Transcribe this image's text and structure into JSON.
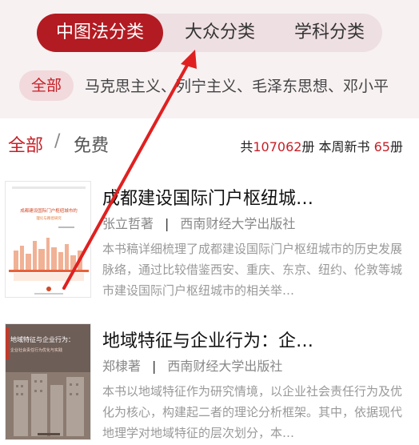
{
  "tabs": [
    {
      "label": "中图法分类",
      "active": true
    },
    {
      "label": "大众分类",
      "active": false
    },
    {
      "label": "学科分类",
      "active": false
    }
  ],
  "categories": {
    "all_label": "全部",
    "items_text": "马克思主义、列宁主义、毛泽东思想、邓小平"
  },
  "filter": {
    "all_label": "全部",
    "separator": "/",
    "free_label": "免费"
  },
  "stats": {
    "prefix": "共",
    "total": "107062",
    "total_unit": "册 本周新书 ",
    "new": "65",
    "new_unit": "册"
  },
  "books": [
    {
      "title": "成都建设国际门户枢纽城…",
      "author": "张立哲著",
      "publisher": "西南财经大学出版社",
      "description": "本书稿详细梳理了成都建设国际门户枢纽城市的历史发展脉络，通过比较借鉴西安、重庆、东京、纽约、伦敦等城市建设国际门户枢纽城市的相关举…",
      "cover_title": "成都建设国际门户枢纽城市的",
      "cover_subtitle": "理论与路径研究"
    },
    {
      "title": "地域特征与企业行为：企…",
      "author": "郑棣著",
      "publisher": "西南财经大学出版社",
      "description": "本书以地域特征作为研究情境，以企业社会责任行为及优化为核心，构建起二者的理论分析框架。其中，依据现代地理学对地域特征的层次划分，本…",
      "cover_title": "地域特征与企业行为：",
      "cover_subtitle": "企业社会责任行为优化与实践"
    }
  ],
  "colors": {
    "accent": "#b31b22",
    "accent_text": "#c52028",
    "top_bg": "#f7f1f2",
    "segment_bg": "#eedfe2",
    "arrow": "#e02020"
  }
}
